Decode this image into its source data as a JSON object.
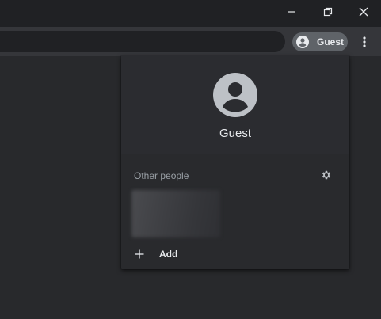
{
  "toolbar": {
    "profile_chip_label": "Guest"
  },
  "popup": {
    "profile_name": "Guest",
    "other_people_title": "Other people",
    "add_label": "Add"
  },
  "icons": {
    "minimize": "minimize-icon",
    "restore": "restore-icon",
    "close": "close-icon",
    "avatar": "person-icon",
    "menu": "vertical-dots-icon",
    "settings": "gear-icon",
    "add": "plus-icon"
  },
  "colors": {
    "window_bg": "#202124",
    "toolbar_bg": "#35363a",
    "popup_bg": "#292a2d",
    "chip_bg": "#5f6368",
    "text_primary": "#e8eaed",
    "text_secondary": "#9aa0a6"
  }
}
